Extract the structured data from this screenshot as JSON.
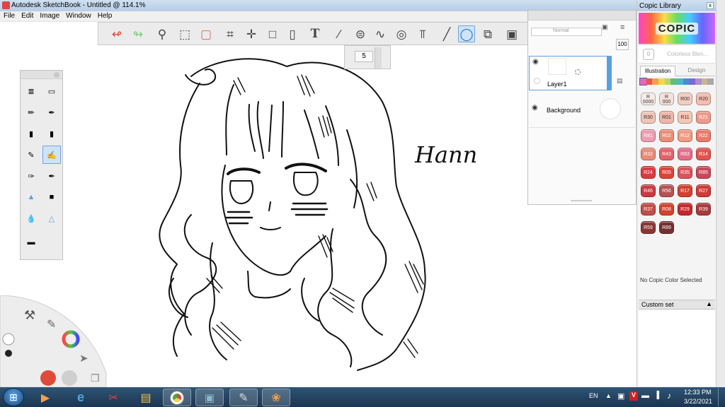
{
  "window": {
    "title": "Autodesk SketchBook - Untitled @ 114.1%"
  },
  "menu": [
    "File",
    "Edit",
    "Image",
    "Window",
    "Help"
  ],
  "toolbar": {
    "tools": [
      "undo-icon",
      "redo-icon",
      "zoom-icon",
      "select-icon",
      "crop-select-icon",
      "crop-icon",
      "lasso-icon",
      "distort-icon",
      "bucket-icon",
      "text-icon",
      "ruler-icon",
      "ellipse-ruler-icon",
      "french-curve-icon",
      "perspective-icon",
      "symmetry-icon",
      "stroke-icon",
      "ellipse-icon",
      "shapes-icon",
      "copic-icon",
      "brush-library-icon",
      "color-wheel-icon",
      "layout-icon"
    ],
    "selected": "ellipse-icon"
  },
  "brush_size": {
    "value": "5"
  },
  "layers": {
    "mode": "Normal",
    "opacity": "100",
    "items": [
      {
        "name": "Layer1",
        "selected": true
      },
      {
        "name": "Background",
        "selected": false
      }
    ]
  },
  "canvas": {
    "signature": "Hann"
  },
  "copic": {
    "title": "Copic Library",
    "close": "x",
    "logo": "COPIC",
    "colorless_label": "Colorless Blen...",
    "colorless_code": "0",
    "tabs": [
      "Illustration",
      "Design"
    ],
    "active_tab": "Illustration",
    "hues": [
      "#e46ab0",
      "#e54",
      "#f6a04a",
      "#f6d94a",
      "#b9d66a",
      "#5cc07a",
      "#4bb9c8",
      "#4a8bd8",
      "#7a6ad0",
      "#b08cc8",
      "#c6b49a",
      "#a8a8a8"
    ],
    "chips": [
      {
        "code": "R\n0000",
        "color": "#f6ece8"
      },
      {
        "code": "R\n000",
        "color": "#f5e1db"
      },
      {
        "code": "R00",
        "color": "#f3cdbf"
      },
      {
        "code": "R20",
        "color": "#f5bdb0"
      },
      {
        "code": "R30",
        "color": "#f0c4b8"
      },
      {
        "code": "R01",
        "color": "#eeb7a8"
      },
      {
        "code": "R11",
        "color": "#f4c6b6"
      },
      {
        "code": "R21",
        "color": "#ec9a8c"
      },
      {
        "code": "R81",
        "color": "#ec9db1"
      },
      {
        "code": "R02",
        "color": "#e98e78"
      },
      {
        "code": "R12",
        "color": "#ee9c83"
      },
      {
        "code": "R22",
        "color": "#ea7a6d"
      },
      {
        "code": "R32",
        "color": "#e98b7a"
      },
      {
        "code": "R43",
        "color": "#e4616a"
      },
      {
        "code": "R83",
        "color": "#e36d8a"
      },
      {
        "code": "R14",
        "color": "#e0544d"
      },
      {
        "code": "R24",
        "color": "#dc3a40"
      },
      {
        "code": "R05",
        "color": "#dd4438"
      },
      {
        "code": "R35",
        "color": "#d8555c"
      },
      {
        "code": "R85",
        "color": "#c8485a"
      },
      {
        "code": "R46",
        "color": "#c93a42"
      },
      {
        "code": "R56",
        "color": "#b5534f"
      },
      {
        "code": "R17",
        "color": "#d2402f"
      },
      {
        "code": "R27",
        "color": "#d03a36"
      },
      {
        "code": "R37",
        "color": "#bf4d4a"
      },
      {
        "code": "R08",
        "color": "#d2432d"
      },
      {
        "code": "R29",
        "color": "#c3282d"
      },
      {
        "code": "R39",
        "color": "#a83a3d"
      },
      {
        "code": "R59",
        "color": "#8a3733"
      },
      {
        "code": "R89",
        "color": "#74302f"
      }
    ],
    "no_selection": "No Copic Color Selected",
    "custom_set": "Custom set"
  },
  "taskbar": {
    "apps": [
      "explorer-ie-icon",
      "media-player-icon",
      "internet-explorer-icon",
      "paint-icon",
      "folder-icon",
      "chrome-icon",
      "images-icon",
      "sketchbook-icon",
      "paint-net-icon"
    ],
    "active_app": "sketchbook-icon",
    "language": "EN",
    "time": "12:33 PM",
    "date": "3/22/2021"
  },
  "colors": {
    "accent": "#4a90d9",
    "taskbar": "#1f3d5a",
    "undo": "#e04a3a",
    "redo": "#7ecb7e"
  }
}
